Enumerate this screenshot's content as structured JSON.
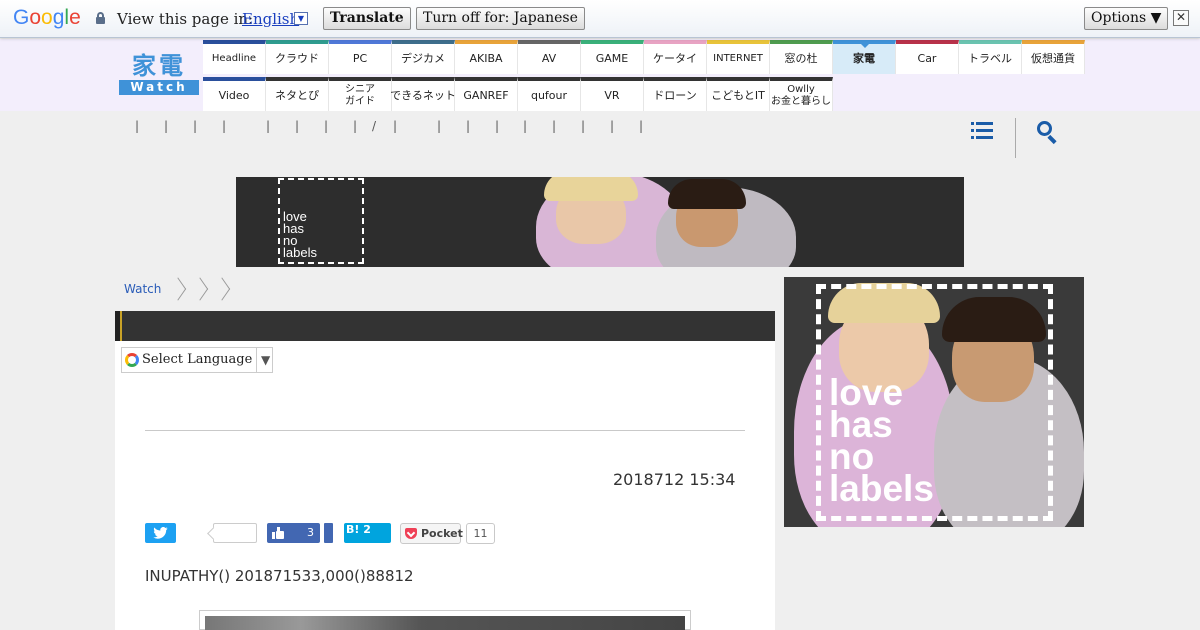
{
  "translate_bar": {
    "logo_letters": [
      {
        "ch": "G",
        "color": "#4285f4"
      },
      {
        "ch": "o",
        "color": "#ea4335"
      },
      {
        "ch": "o",
        "color": "#fbbc05"
      },
      {
        "ch": "g",
        "color": "#4285f4"
      },
      {
        "ch": "l",
        "color": "#34a853"
      },
      {
        "ch": "e",
        "color": "#ea4335"
      }
    ],
    "view_label": "View this page in:",
    "language": "English",
    "dropdown_glyph": "▼",
    "translate_button": "Translate",
    "turn_off_button": "Turn off for: Japanese",
    "options_button": "Options ▼",
    "close_glyph": "✕"
  },
  "header": {
    "logo_top": "家電",
    "logo_bottom": "Watch",
    "nav_row1": [
      {
        "label": "Headline",
        "color": "#2a4f9c"
      },
      {
        "label": "クラウド",
        "color": "#2f9c8f"
      },
      {
        "label": "PC",
        "color": "#4f78d8"
      },
      {
        "label": "デジカメ",
        "color": "#3e6e8c"
      },
      {
        "label": "AKIBA",
        "color": "#e8a33a"
      },
      {
        "label": "AV",
        "color": "#666666"
      },
      {
        "label": "GAME",
        "color": "#3ab07a"
      },
      {
        "label": "ケータイ",
        "color": "#e8a3c3"
      },
      {
        "label": "INTERNET",
        "color": "#e8c33a"
      },
      {
        "label": "窓の杜",
        "color": "#4f9c4f"
      },
      {
        "label": "家電",
        "color": "#3f92d8",
        "active": true
      },
      {
        "label": "Car",
        "color": "#b8324a"
      },
      {
        "label": "トラベル",
        "color": "#6ac3b0"
      },
      {
        "label": "仮想通貨",
        "color": "#e8a33a"
      }
    ],
    "nav_row2": [
      {
        "label": "Video",
        "color": "#2a4f9c"
      },
      {
        "label": "ネタとぴ",
        "color": "#333333"
      },
      {
        "label": "シニア\nガイド",
        "color": "#333333"
      },
      {
        "label": "できるネット",
        "color": "#333333"
      },
      {
        "label": "GANREF",
        "color": "#333333"
      },
      {
        "label": "qufour",
        "color": "#333333"
      },
      {
        "label": "VR",
        "color": "#333333"
      },
      {
        "label": "ドローン",
        "color": "#333333"
      },
      {
        "label": "こどもとIT",
        "color": "#333333"
      },
      {
        "label": "Owlly\nお金と暮らし",
        "color": "#333333"
      }
    ]
  },
  "subnav": {
    "separators": [
      "|",
      "|",
      "|",
      "|",
      "|",
      "|",
      "|",
      "|",
      "/",
      "|",
      "|",
      "|",
      "|",
      "|",
      "|",
      "|",
      "|",
      "|"
    ]
  },
  "ads": {
    "banner_text": "love\nhas\nno\nlabels",
    "side_text": "love\nhas\nno\nlabels"
  },
  "breadcrumb": {
    "root": "Watch"
  },
  "language_select": {
    "label": "Select Language",
    "arrow": "▼"
  },
  "article": {
    "date": "2018712 15:34",
    "lede": "INUPATHY() 201871533,000()88812",
    "share": {
      "facebook_count": "3",
      "hatena_label": "B! 2",
      "pocket_label": "Pocket",
      "pocket_count": "11"
    }
  }
}
